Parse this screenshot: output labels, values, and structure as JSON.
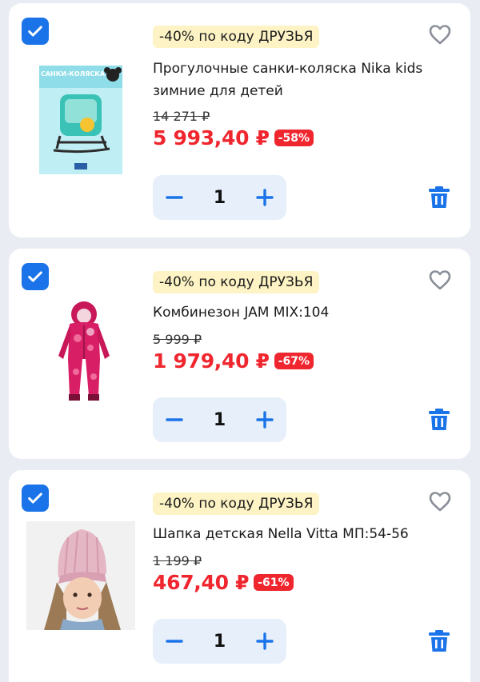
{
  "colors": {
    "accent": "#1a73e8",
    "price_red": "#f0262f",
    "promo_bg": "#fdf3c4",
    "stepper_bg": "#e6effa"
  },
  "items": [
    {
      "promo": "-40% по коду ДРУЗЬЯ",
      "title": "Прогулочные санки-коляска Nika kids зимние для детей",
      "old_price": "14 271 ₽",
      "price": "5 993,40 ₽",
      "discount": "-58%",
      "qty": "1",
      "thumb_caption": "САНКИ-КОЛЯСКА",
      "selected": true
    },
    {
      "promo": "-40% по коду ДРУЗЬЯ",
      "title": "Комбинезон JAM MIX:104",
      "old_price": "5 999 ₽",
      "price": "1 979,40 ₽",
      "discount": "-67%",
      "qty": "1",
      "selected": true
    },
    {
      "promo": "-40% по коду ДРУЗЬЯ",
      "title": "Шапка детская Nella Vitta МП:54-56",
      "old_price": "1 199 ₽",
      "price": "467,40 ₽",
      "discount": "-61%",
      "qty": "1",
      "selected": true
    }
  ],
  "icons": {
    "checkbox": "check-icon",
    "favorite": "heart-icon",
    "decrement": "minus-icon",
    "increment": "plus-icon",
    "delete": "trash-icon"
  }
}
